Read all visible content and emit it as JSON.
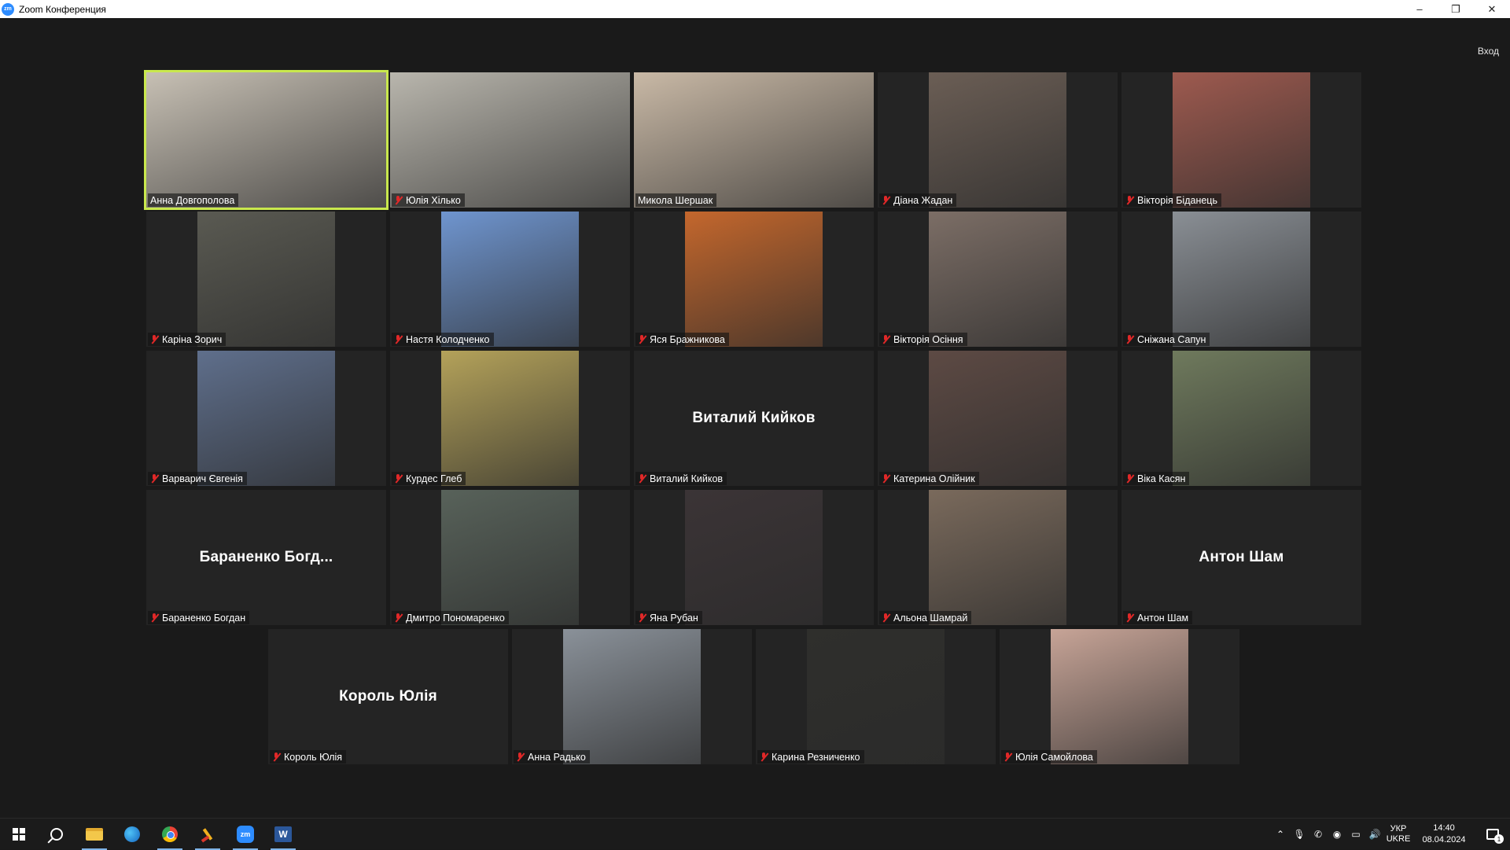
{
  "window": {
    "logo": "zm",
    "title": "Zoom Конференция",
    "controls": {
      "minimize": "–",
      "restore": "❐",
      "close": "✕"
    }
  },
  "signin_label": "Вход",
  "participants": [
    {
      "name": "Анна Довгополова",
      "muted": false,
      "active": true,
      "video": "full",
      "color": "#c7c0b4"
    },
    {
      "name": "Юлія Хілько",
      "muted": true,
      "video": "full",
      "color": "#b9b6ad"
    },
    {
      "name": "Микола Шершак",
      "muted": false,
      "video": "full",
      "color": "#c9b9a6"
    },
    {
      "name": "Діана Жадан",
      "muted": true,
      "video": "center",
      "color": "#6b5e55"
    },
    {
      "name": "Вікторія Біданець",
      "muted": true,
      "video": "center",
      "color": "#9e5a4f"
    },
    {
      "name": "Каріна Зорич",
      "muted": true,
      "video": "center",
      "color": "#5a5a52"
    },
    {
      "name": "Настя Колодченко",
      "muted": true,
      "video": "center",
      "color": "#6f95cf"
    },
    {
      "name": "Яся Бражникова",
      "muted": true,
      "video": "center",
      "color": "#c4672d"
    },
    {
      "name": "Вікторія Осіння",
      "muted": true,
      "video": "center",
      "color": "#7c6e66"
    },
    {
      "name": "Сніжана Сапун",
      "muted": true,
      "video": "center",
      "color": "#8a8f95"
    },
    {
      "name": "Варварич Євгенія",
      "muted": true,
      "video": "center",
      "color": "#5f6f8c"
    },
    {
      "name": "Курдес Глеб",
      "muted": true,
      "video": "center",
      "color": "#b4a25a"
    },
    {
      "name": "Виталий Кийков",
      "muted": true,
      "video": "none",
      "big_label": "Виталий Кийков"
    },
    {
      "name": "Катерина Олійник",
      "muted": true,
      "video": "center",
      "color": "#5d4a44"
    },
    {
      "name": "Віка Касян",
      "muted": true,
      "video": "center",
      "color": "#6f7a5d"
    },
    {
      "name": "Бараненко Богдан",
      "muted": true,
      "video": "none",
      "big_label": "Бараненко Богд..."
    },
    {
      "name": "Дмитро Пономаренко",
      "muted": true,
      "video": "center",
      "color": "#58625a"
    },
    {
      "name": "Яна Рубан",
      "muted": true,
      "video": "center",
      "color": "#3b3436"
    },
    {
      "name": "Альона Шамрай",
      "muted": true,
      "video": "center",
      "color": "#7a6a5c"
    },
    {
      "name": "Антон Шам",
      "muted": true,
      "video": "none",
      "big_label": "Антон Шам"
    },
    {
      "name": "Король Юлія",
      "muted": true,
      "video": "none",
      "big_label": "Король Юлія"
    },
    {
      "name": "Анна Радько",
      "muted": true,
      "video": "center",
      "color": "#8a9199"
    },
    {
      "name": "Карина Резниченко",
      "muted": true,
      "video": "center",
      "color": "#2f2f2c"
    },
    {
      "name": "Юлія Самойлова",
      "muted": true,
      "video": "center",
      "color": "#c7a497"
    }
  ],
  "taskbar": {
    "apps": [
      {
        "id": "start",
        "icon": "windows-start-icon"
      },
      {
        "id": "search",
        "icon": "search-icon"
      },
      {
        "id": "explorer",
        "icon": "folder-icon",
        "open": true
      },
      {
        "id": "browser",
        "icon": "edge-icon"
      },
      {
        "id": "chrome",
        "icon": "chrome-icon",
        "open": true
      },
      {
        "id": "tool",
        "icon": "tool-icon",
        "open": true
      },
      {
        "id": "zoom",
        "icon": "zoom-icon",
        "label": "zm",
        "open": true
      },
      {
        "id": "word",
        "icon": "word-icon",
        "label": "W",
        "open": true
      }
    ],
    "tray_icons": [
      "chevron-up-icon",
      "microphone-icon",
      "viber-icon",
      "app-icon",
      "network-icon",
      "volume-icon"
    ],
    "language_top": "УКР",
    "language_bottom": "UKRE",
    "time": "14:40",
    "date": "08.04.2024",
    "notification_count": "1"
  }
}
